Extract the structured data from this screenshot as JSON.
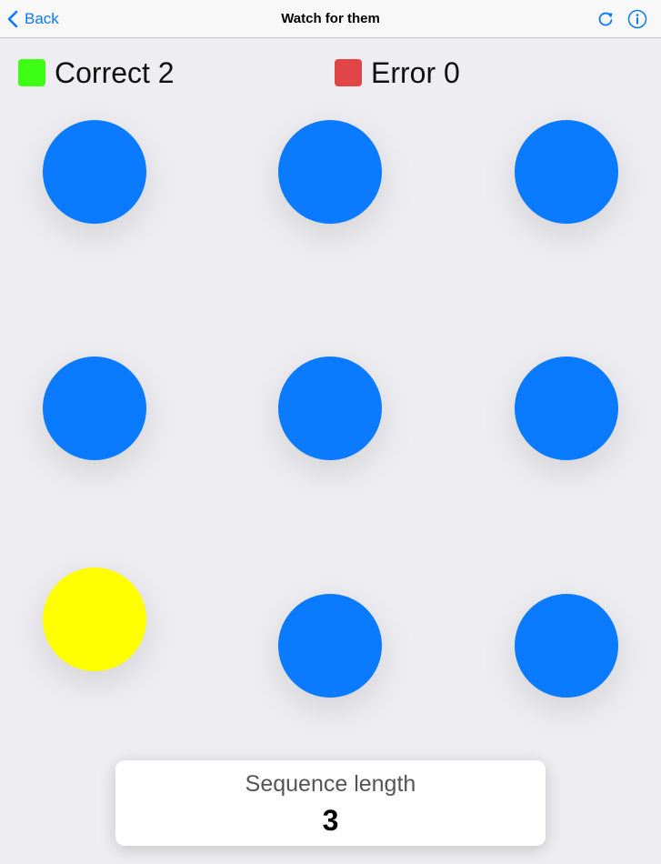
{
  "navbar": {
    "back_label": "Back",
    "title": "Watch for them",
    "icons": [
      "chevron-left-icon",
      "refresh-icon",
      "info-icon"
    ]
  },
  "score": {
    "correct_label": "Correct 2",
    "error_label": "Error 0"
  },
  "colors": {
    "accent": "#0a7aff",
    "circle_default": "#0a7aff",
    "circle_highlight": "#ffff00",
    "correct_swatch": "#3dff14",
    "error_swatch": "#e24545"
  },
  "grid": {
    "rows": 3,
    "columns": 3,
    "highlighted_circle": "row 3, column 1"
  },
  "sequence": {
    "label": "Sequence length",
    "value": "3"
  }
}
